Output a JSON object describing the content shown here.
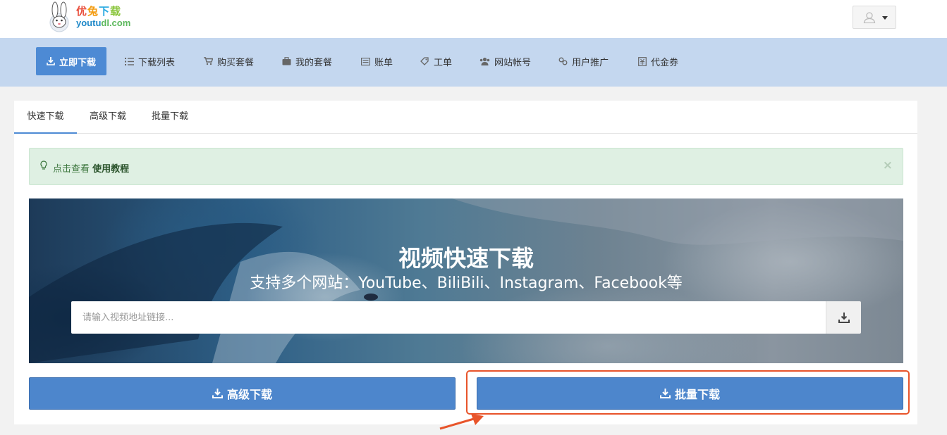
{
  "header": {
    "logo_cn": [
      "优",
      "兔",
      "下",
      "载"
    ],
    "logo_en_a": "youtu",
    "logo_en_b": "dl.com",
    "user_icon": "user-icon"
  },
  "nav": {
    "items": [
      {
        "label": "立即下载",
        "icon": "download-icon"
      },
      {
        "label": "下载列表",
        "icon": "list-icon"
      },
      {
        "label": "购买套餐",
        "icon": "cart-icon"
      },
      {
        "label": "我的套餐",
        "icon": "briefcase-icon"
      },
      {
        "label": "账单",
        "icon": "bill-icon"
      },
      {
        "label": "工单",
        "icon": "tag-icon"
      },
      {
        "label": "网站帐号",
        "icon": "users-icon"
      },
      {
        "label": "用户推广",
        "icon": "link-icon"
      },
      {
        "label": "代金券",
        "icon": "coupon-icon"
      }
    ]
  },
  "tabs": [
    "快速下载",
    "高级下载",
    "批量下载"
  ],
  "alert": {
    "text": "点击查看",
    "link": "使用教程",
    "close": "×"
  },
  "hero": {
    "title": "视频快速下载",
    "subtitle": "支持多个网站：YouTube、BiliBili、Instagram、Facebook等",
    "input_placeholder": "请输入视频地址链接..."
  },
  "buttons": {
    "advanced": "高级下载",
    "batch": "批量下载"
  },
  "colors": {
    "primary": "#4d86cc",
    "nav_bg": "#c4d7ef",
    "alert_bg": "#dff0e3",
    "highlight": "#e8542a"
  }
}
